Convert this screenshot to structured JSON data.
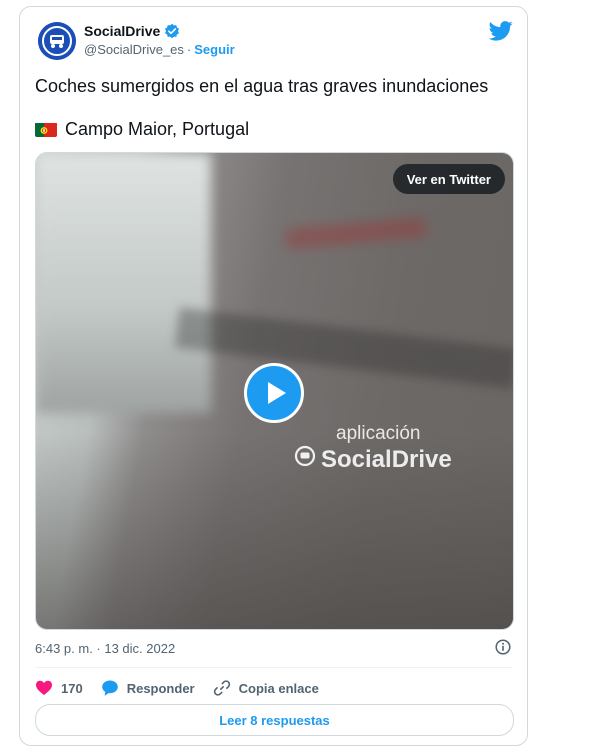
{
  "tweet": {
    "display_name": "SocialDrive",
    "handle": "@SocialDrive_es",
    "separator": "·",
    "follow_label": "Seguir",
    "text": "Coches sumergidos en el agua tras graves inundaciones",
    "location": "Campo Maior, Portugal",
    "timestamp": "6:43 p. m. · 13 dic. 2022"
  },
  "media": {
    "view_button_label": "Ver en Twitter",
    "watermark_line1": "aplicación",
    "watermark_line2": "SocialDrive"
  },
  "actions": {
    "like_count": "170",
    "reply_label": "Responder",
    "copy_link_label": "Copia enlace"
  },
  "footer": {
    "read_replies_label": "Leer 8 respuestas"
  },
  "colors": {
    "accent": "#1d9bf0",
    "like": "#f91880",
    "secondary_text": "#536471"
  },
  "icons": [
    "verified-badge-icon",
    "twitter-bird-icon",
    "portugal-flag-icon",
    "play-icon",
    "info-icon",
    "heart-icon",
    "comment-bubble-icon",
    "link-icon"
  ]
}
